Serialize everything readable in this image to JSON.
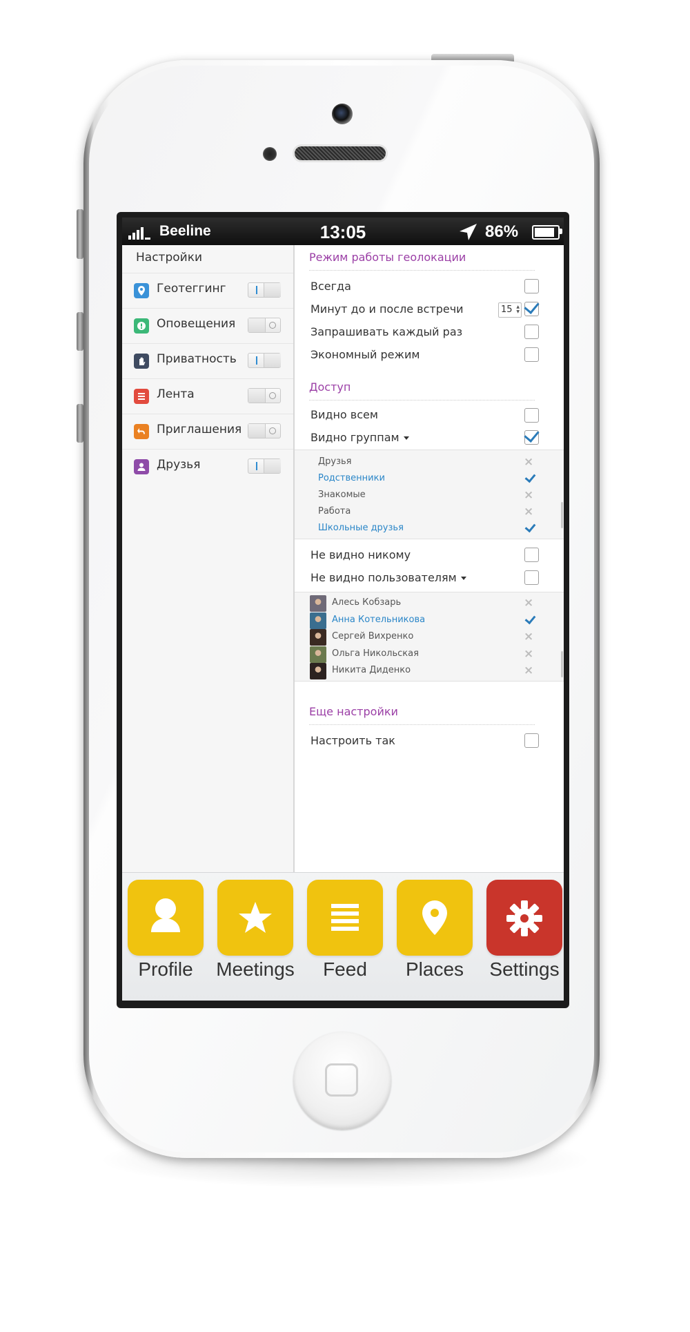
{
  "status_bar": {
    "carrier": "Beeline",
    "time": "13:05",
    "battery": "86%",
    "battery_level": 0.86,
    "signal_bars": 4
  },
  "sidebar": {
    "title": "Настройки",
    "items": [
      {
        "label": "Геотеггинг",
        "icon": "map-pin-icon",
        "color": "#3a92d8",
        "toggle": "on"
      },
      {
        "label": "Оповещения",
        "icon": "alert-icon",
        "color": "#3cb878",
        "toggle": "off"
      },
      {
        "label": "Приватность",
        "icon": "hand-icon",
        "color": "#3f4b61",
        "toggle": "on"
      },
      {
        "label": "Лента",
        "icon": "list-icon",
        "color": "#e24b3e",
        "toggle": "off"
      },
      {
        "label": "Приглашения",
        "icon": "reply-icon",
        "color": "#ea8122",
        "toggle": "off"
      },
      {
        "label": "Друзья",
        "icon": "person-icon",
        "color": "#8e4ba8",
        "toggle": "on"
      }
    ]
  },
  "geolocation": {
    "title": "Режим работы геолокации",
    "options": [
      {
        "label": "Всегда",
        "checked": false
      },
      {
        "label": "Минут до и после встречи",
        "checked": true,
        "stepper_value": "15"
      },
      {
        "label": "Запрашивать каждый раз",
        "checked": false
      },
      {
        "label": "Экономный режим",
        "checked": false
      }
    ]
  },
  "access": {
    "title": "Доступ",
    "visible_all": {
      "label": "Видно всем",
      "checked": false
    },
    "visible_groups": {
      "label": "Видно группам",
      "checked": true
    },
    "groups": [
      {
        "label": "Друзья",
        "selected": false
      },
      {
        "label": "Родственники",
        "selected": true
      },
      {
        "label": "Знакомые",
        "selected": false
      },
      {
        "label": "Работа",
        "selected": false
      },
      {
        "label": "Школьные друзья",
        "selected": true
      }
    ],
    "visible_none": {
      "label": "Не видно никому",
      "checked": false
    },
    "hidden_users": {
      "label": "Не видно пользователям",
      "checked": false
    },
    "users": [
      {
        "label": "Алесь Кобзарь",
        "selected": false,
        "avatar_color": "#6f6a78"
      },
      {
        "label": "Анна Котельникова",
        "selected": true,
        "avatar_color": "#3a6e8f"
      },
      {
        "label": "Сергей Вихренко",
        "selected": false,
        "avatar_color": "#3a2a22"
      },
      {
        "label": "Ольга Никольская",
        "selected": false,
        "avatar_color": "#6b7a4e"
      },
      {
        "label": "Никита Диденко",
        "selected": false,
        "avatar_color": "#2c2220"
      }
    ]
  },
  "more": {
    "title": "Еще настройки",
    "options": [
      {
        "label": "Настроить так",
        "checked": false
      }
    ]
  },
  "tabbar": {
    "tabs": [
      {
        "label": "Profile",
        "icon": "person-icon",
        "color": "#f0c30f"
      },
      {
        "label": "Meetings",
        "icon": "star-icon",
        "color": "#f0c30f"
      },
      {
        "label": "Feed",
        "icon": "list-icon",
        "color": "#f0c30f"
      },
      {
        "label": "Places",
        "icon": "map-pin-icon",
        "color": "#f0c30f"
      },
      {
        "label": "Settings",
        "icon": "gear-icon",
        "color": "#c9352b",
        "active": true
      }
    ]
  }
}
